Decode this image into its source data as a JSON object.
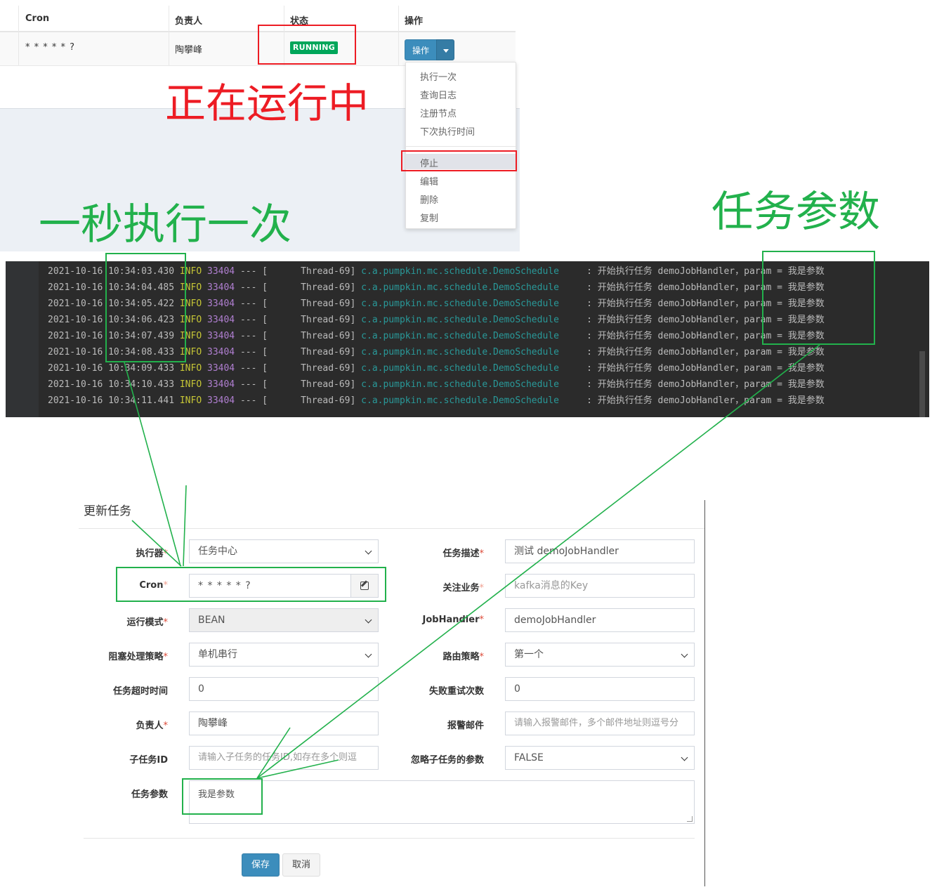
{
  "table": {
    "headers": [
      "Cron",
      "负责人",
      "状态",
      "操作"
    ],
    "row": {
      "cron": "* * * * * ?",
      "owner": "陶攀峰",
      "status": "RUNNING",
      "op_label": "操作"
    }
  },
  "dropdown": {
    "items": [
      "执行一次",
      "查询日志",
      "注册节点",
      "下次执行时间"
    ],
    "items2": [
      "停止",
      "编辑",
      "删除",
      "复制"
    ]
  },
  "annotations": {
    "running": "正在运行中",
    "per_second": "一秒执行一次",
    "task_param": "任务参数"
  },
  "log": {
    "lines": [
      {
        "date": "2021-10-16",
        "time": "10:34:03.430",
        "level": "INFO",
        "pid": "33404",
        "sep": "---",
        "thread": "[      Thread-69]",
        "cls": "c.a.pumpkin.mc.schedule.DemoSchedule",
        "msg": ": 开始执行任务 demoJobHandler，param = 我是参数"
      },
      {
        "date": "2021-10-16",
        "time": "10:34:04.485",
        "level": "INFO",
        "pid": "33404",
        "sep": "---",
        "thread": "[      Thread-69]",
        "cls": "c.a.pumpkin.mc.schedule.DemoSchedule",
        "msg": ": 开始执行任务 demoJobHandler，param = 我是参数"
      },
      {
        "date": "2021-10-16",
        "time": "10:34:05.422",
        "level": "INFO",
        "pid": "33404",
        "sep": "---",
        "thread": "[      Thread-69]",
        "cls": "c.a.pumpkin.mc.schedule.DemoSchedule",
        "msg": ": 开始执行任务 demoJobHandler，param = 我是参数"
      },
      {
        "date": "2021-10-16",
        "time": "10:34:06.423",
        "level": "INFO",
        "pid": "33404",
        "sep": "---",
        "thread": "[      Thread-69]",
        "cls": "c.a.pumpkin.mc.schedule.DemoSchedule",
        "msg": ": 开始执行任务 demoJobHandler，param = 我是参数"
      },
      {
        "date": "2021-10-16",
        "time": "10:34:07.439",
        "level": "INFO",
        "pid": "33404",
        "sep": "---",
        "thread": "[      Thread-69]",
        "cls": "c.a.pumpkin.mc.schedule.DemoSchedule",
        "msg": ": 开始执行任务 demoJobHandler，param = 我是参数"
      },
      {
        "date": "2021-10-16",
        "time": "10:34:08.433",
        "level": "INFO",
        "pid": "33404",
        "sep": "---",
        "thread": "[      Thread-69]",
        "cls": "c.a.pumpkin.mc.schedule.DemoSchedule",
        "msg": ": 开始执行任务 demoJobHandler，param = 我是参数"
      },
      {
        "date": "2021-10-16",
        "time": "10:34:09.433",
        "level": "INFO",
        "pid": "33404",
        "sep": "---",
        "thread": "[      Thread-69]",
        "cls": "c.a.pumpkin.mc.schedule.DemoSchedule",
        "msg": ": 开始执行任务 demoJobHandler，param = 我是参数"
      },
      {
        "date": "2021-10-16",
        "time": "10:34:10.433",
        "level": "INFO",
        "pid": "33404",
        "sep": "---",
        "thread": "[      Thread-69]",
        "cls": "c.a.pumpkin.mc.schedule.DemoSchedule",
        "msg": ": 开始执行任务 demoJobHandler，param = 我是参数"
      },
      {
        "date": "2021-10-16",
        "time": "10:34:11.441",
        "level": "INFO",
        "pid": "33404",
        "sep": "---",
        "thread": "[      Thread-69]",
        "cls": "c.a.pumpkin.mc.schedule.DemoSchedule",
        "msg": ": 开始执行任务 demoJobHandler，param = 我是参数"
      }
    ]
  },
  "form": {
    "title": "更新任务",
    "executor_label": "执行器",
    "executor_value": "任务中心",
    "desc_label": "任务描述",
    "desc_value": "测试 demoJobHandler",
    "cron_label": "Cron",
    "cron_value": "* * * * * ?",
    "focus_label": "关注业务",
    "focus_placeholder": "kafka消息的Key",
    "mode_label": "运行模式",
    "mode_value": "BEAN",
    "handler_label": "JobHandler",
    "handler_value": "demoJobHandler",
    "block_label": "阻塞处理策略",
    "block_value": "单机串行",
    "route_label": "路由策略",
    "route_value": "第一个",
    "timeout_label": "任务超时时间",
    "timeout_value": "0",
    "retry_label": "失败重试次数",
    "retry_value": "0",
    "owner_label": "负责人",
    "owner_value": "陶攀峰",
    "email_label": "报警邮件",
    "email_placeholder": "请输入报警邮件，多个邮件地址则逗号分",
    "child_label": "子任务ID",
    "child_placeholder": "请输入子任务的任务ID,如存在多个则逗",
    "ignore_label": "忽略子任务的参数",
    "ignore_value": "FALSE",
    "param_label": "任务参数",
    "param_value": "我是参数",
    "save_label": "保存",
    "cancel_label": "取消"
  },
  "colors": {
    "primary": "#3c8dbc",
    "success": "#00a65a",
    "annotation_red": "#ed1c24",
    "annotation_green": "#22b14c"
  }
}
